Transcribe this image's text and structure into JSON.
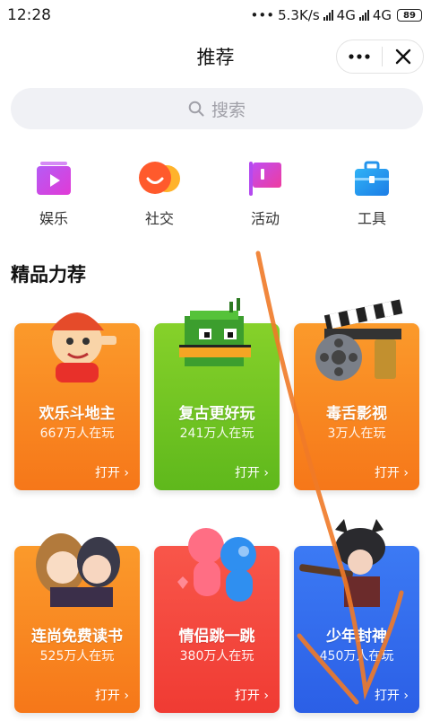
{
  "status_bar": {
    "time": "12:28",
    "net_speed": "5.3K/s",
    "net1": "4G",
    "net2": "4G",
    "battery": "89"
  },
  "header": {
    "title": "推荐"
  },
  "search": {
    "placeholder": "搜索"
  },
  "categories": [
    {
      "label": "娱乐"
    },
    {
      "label": "社交"
    },
    {
      "label": "活动"
    },
    {
      "label": "工具"
    }
  ],
  "section": {
    "title": "精品力荐"
  },
  "games": [
    {
      "name": "欢乐斗地主",
      "players": "667万人在玩",
      "open": "打开"
    },
    {
      "name": "复古更好玩",
      "players": "241万人在玩",
      "open": "打开"
    },
    {
      "name": "毒舌影视",
      "players": "3万人在玩",
      "open": "打开"
    },
    {
      "name": "连尚免费读书",
      "players": "525万人在玩",
      "open": "打开"
    },
    {
      "name": "情侣跳一跳",
      "players": "380万人在玩",
      "open": "打开"
    },
    {
      "name": "少年封神",
      "players": "450万人在玩",
      "open": "打开"
    }
  ],
  "colors": {
    "orange_card": "#f7851f",
    "green_card": "#6cc21f",
    "red_card": "#f2473a",
    "blue_card": "#2f6df0",
    "annotation_stroke": "#f07a28"
  }
}
